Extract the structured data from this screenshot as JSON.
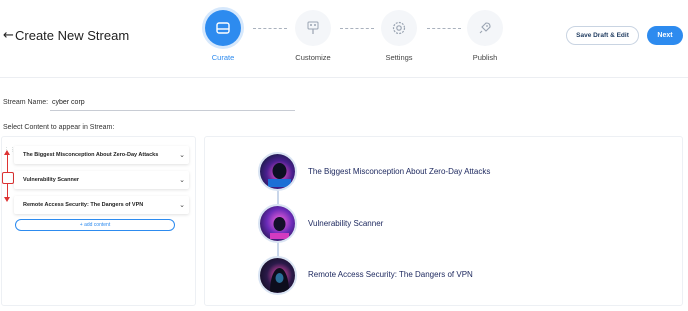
{
  "header": {
    "back_icon": "arrow-left-icon",
    "title": "Create New Stream",
    "steps": [
      {
        "label": "Curate",
        "icon": "tray-icon",
        "active": true
      },
      {
        "label": "Customize",
        "icon": "palette-icon",
        "active": false
      },
      {
        "label": "Settings",
        "icon": "gear-icon",
        "active": false
      },
      {
        "label": "Publish",
        "icon": "rocket-icon",
        "active": false
      }
    ],
    "save_draft_label": "Save Draft & Edit",
    "next_label": "Next",
    "accent_color": "#2d8bef"
  },
  "form": {
    "stream_name_label": "Stream Name:",
    "stream_name_value": "cyber corp",
    "select_content_label": "Select Content to appear in Stream:"
  },
  "content_list": {
    "items": [
      {
        "title": "The Biggest Misconception About Zero-Day Attacks"
      },
      {
        "title": "Vulnerability Scanner"
      },
      {
        "title": "Remote Access Security: The Dangers of VPN"
      }
    ],
    "add_content_label": "+ add content",
    "annotation_color": "#dd3333"
  },
  "preview": {
    "items": [
      {
        "title": "The Biggest Misconception About Zero-Day Attacks",
        "thumb_icon": "hacker-image"
      },
      {
        "title": "Vulnerability Scanner",
        "thumb_icon": "neon-hacker-image"
      },
      {
        "title": "Remote Access Security: The Dangers of VPN",
        "thumb_icon": "hooded-hacker-image"
      }
    ]
  }
}
